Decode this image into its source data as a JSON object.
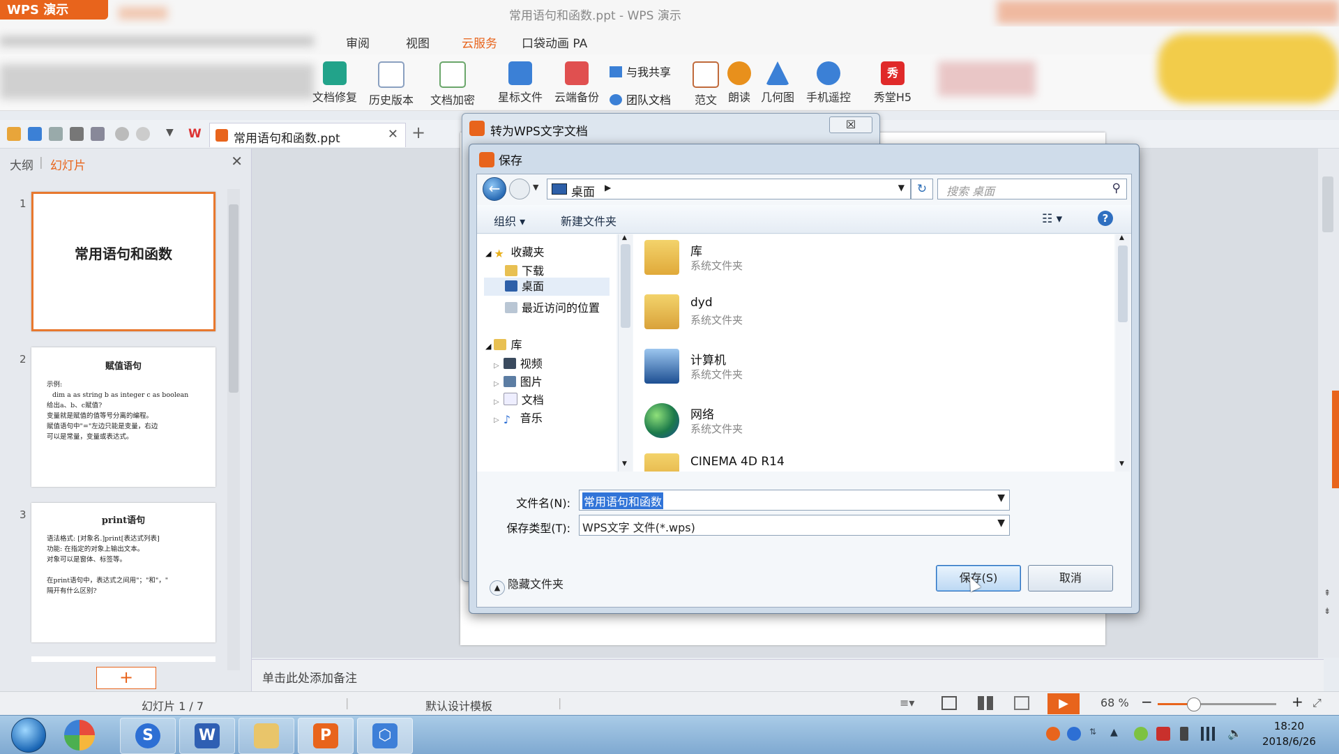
{
  "window": {
    "app_logo": "WPS 演示",
    "title": "常用语句和函数.ppt - WPS 演示"
  },
  "ribbon": {
    "tabs": [
      {
        "label": "审阅",
        "active": false
      },
      {
        "label": "视图",
        "active": false
      },
      {
        "label": "云服务",
        "active": true
      },
      {
        "label": "口袋动画 PA",
        "active": false
      }
    ],
    "buttons": [
      {
        "label": "文档修复",
        "icon": "repair-icon",
        "color": "#22a38a"
      },
      {
        "label": "历史版本",
        "icon": "history-icon",
        "color": "#8aa0c0"
      },
      {
        "label": "文档加密",
        "icon": "encrypt-icon",
        "color": "#6aa66a"
      },
      {
        "label": "星标文件",
        "icon": "star-file-icon",
        "color": "#3b80d6"
      },
      {
        "label": "云端备份",
        "icon": "cloud-backup-icon",
        "color": "#e05050"
      },
      {
        "label": "与我共享",
        "icon": "shared-icon",
        "color": "#3b80d6"
      },
      {
        "label": "团队文档",
        "icon": "team-icon",
        "color": "#3b80d6"
      },
      {
        "label": "范文",
        "icon": "template-icon",
        "color": "#c06a3b"
      },
      {
        "label": "朗读",
        "icon": "read-aloud-icon",
        "color": "#e8901c"
      },
      {
        "label": "几何图",
        "icon": "geometry-icon",
        "color": "#3b80d6"
      },
      {
        "label": "手机遥控",
        "icon": "phone-remote-icon",
        "color": "#3b80d6"
      },
      {
        "label": "秀堂H5",
        "icon": "xiutang-icon",
        "color": "#e02a2a",
        "glyph": "秀"
      }
    ]
  },
  "doc_tab": {
    "label": "常用语句和函数.ppt"
  },
  "left_panel": {
    "tabs": [
      {
        "label": "大纲",
        "active": false
      },
      {
        "label": "幻灯片",
        "active": true
      }
    ],
    "slides": [
      {
        "num": "1",
        "title": "常用语句和函数",
        "lines": []
      },
      {
        "num": "2",
        "title": "赋值语句",
        "lines": [
          "示例:",
          "dim a as string b as integer c as boolean",
          "给出a、b、c赋值?",
          "变量就是赋值的值等号分离的编程。",
          "赋值语句中\"=\"左边只能是变量，右边",
          "可以是常量，变量或表达式。"
        ]
      },
      {
        "num": "3",
        "title": "print语句",
        "lines": [
          "语法格式: [对象名.]print[表达式列表]",
          "功能: 在指定的对象上输出文本。",
          "对象可以是窗体、标签等。",
          "",
          "在print语句中，表达式之间用\"；\"和\"，\"",
          "隔开有什么区别?"
        ]
      }
    ],
    "add_slide": "+"
  },
  "notes": {
    "placeholder": "单击此处添加备注"
  },
  "statusbar": {
    "slide_num": "幻灯片 1 / 7",
    "template": "默认设计模板",
    "zoom": "68 %",
    "zoom_level": 0.68
  },
  "convert_dialog": {
    "title": "转为WPS文字文档",
    "close": "☒"
  },
  "save_dialog": {
    "title": "保存",
    "address": "桌面",
    "search_placeholder": "搜索 桌面",
    "toolbar": {
      "organize": "组织 ▾",
      "new_folder": "新建文件夹"
    },
    "nav": {
      "favorites": "收藏夹",
      "fav_items": [
        "下载",
        "桌面",
        "最近访问的位置"
      ],
      "library": "库",
      "lib_items": [
        "视频",
        "图片",
        "文档",
        "音乐"
      ]
    },
    "files": [
      {
        "name": "库",
        "type": "系统文件夹"
      },
      {
        "name": "dyd",
        "type": "系统文件夹"
      },
      {
        "name": "计算机",
        "type": "系统文件夹"
      },
      {
        "name": "网络",
        "type": "系统文件夹"
      },
      {
        "name": "CINEMA 4D R14",
        "type": ""
      }
    ],
    "filename_label": "文件名(N):",
    "filename": "常用语句和函数",
    "filetype_label": "保存类型(T):",
    "filetype": "WPS文字 文件(*.wps)",
    "hide_folders": "隐藏文件夹",
    "save_button": "保存(S)",
    "cancel_button": "取消"
  },
  "taskbar": {
    "time": "18:20",
    "date": "2018/6/26"
  },
  "colors": {
    "accent": "#e8641c",
    "selection": "#3174d8"
  }
}
